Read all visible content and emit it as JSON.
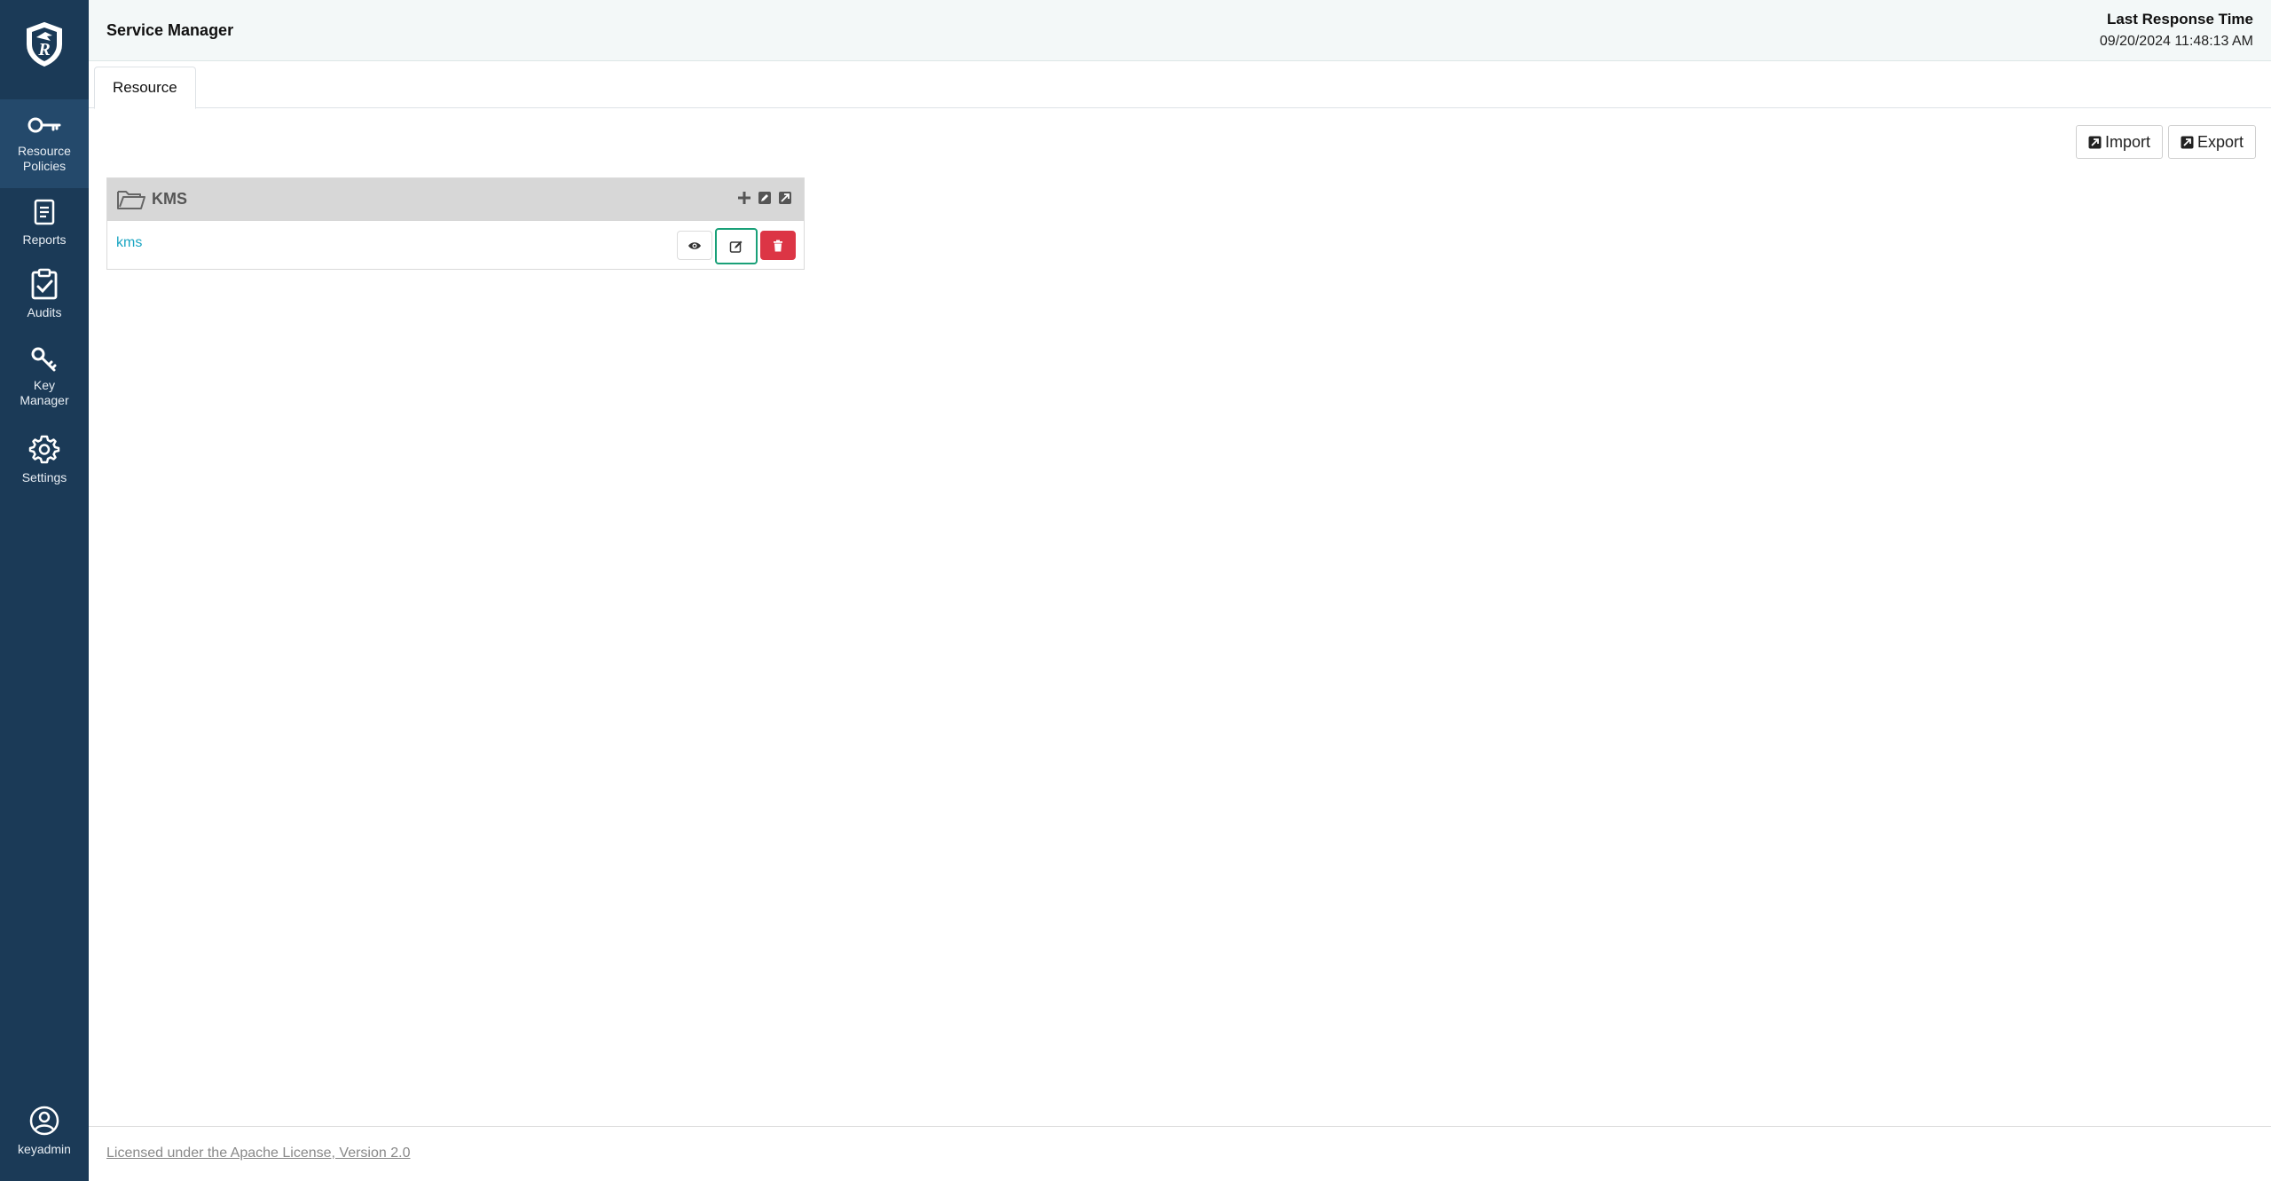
{
  "sidebar": {
    "logo_icon": "ranger-shield-logo-icon",
    "items": [
      {
        "label": "Resource\nPolicies",
        "icon": "key-icon",
        "active": true
      },
      {
        "label": "Reports",
        "icon": "report-icon",
        "active": false
      },
      {
        "label": "Audits",
        "icon": "clipboard-check-icon",
        "active": false
      },
      {
        "label": "Key\nManager",
        "icon": "keys-icon",
        "active": false
      },
      {
        "label": "Settings",
        "icon": "gear-icon",
        "active": false
      }
    ],
    "user": {
      "label": "keyadmin",
      "icon": "user-circle-icon"
    }
  },
  "header": {
    "title": "Service Manager",
    "last_response_label": "Last Response Time",
    "last_response_value": "09/20/2024 11:48:13 AM"
  },
  "tabs": [
    {
      "label": "Resource",
      "active": true
    }
  ],
  "toolbar": {
    "import_label": "Import",
    "export_label": "Export"
  },
  "service_card": {
    "title": "KMS",
    "header_icons": [
      "plus-icon",
      "edit-square-icon",
      "export-square-icon"
    ],
    "services": [
      {
        "name": "kms",
        "actions": [
          "eye-icon",
          "edit-icon",
          "trash-icon"
        ]
      }
    ]
  },
  "footer": {
    "license_text": "Licensed under the Apache License, Version 2.0"
  },
  "colors": {
    "sidebar_bg": "#1b3a57",
    "header_bg": "#f3f8f8",
    "link": "#1aa5c2",
    "delete": "#dc3545",
    "focus_border": "#19a078"
  }
}
